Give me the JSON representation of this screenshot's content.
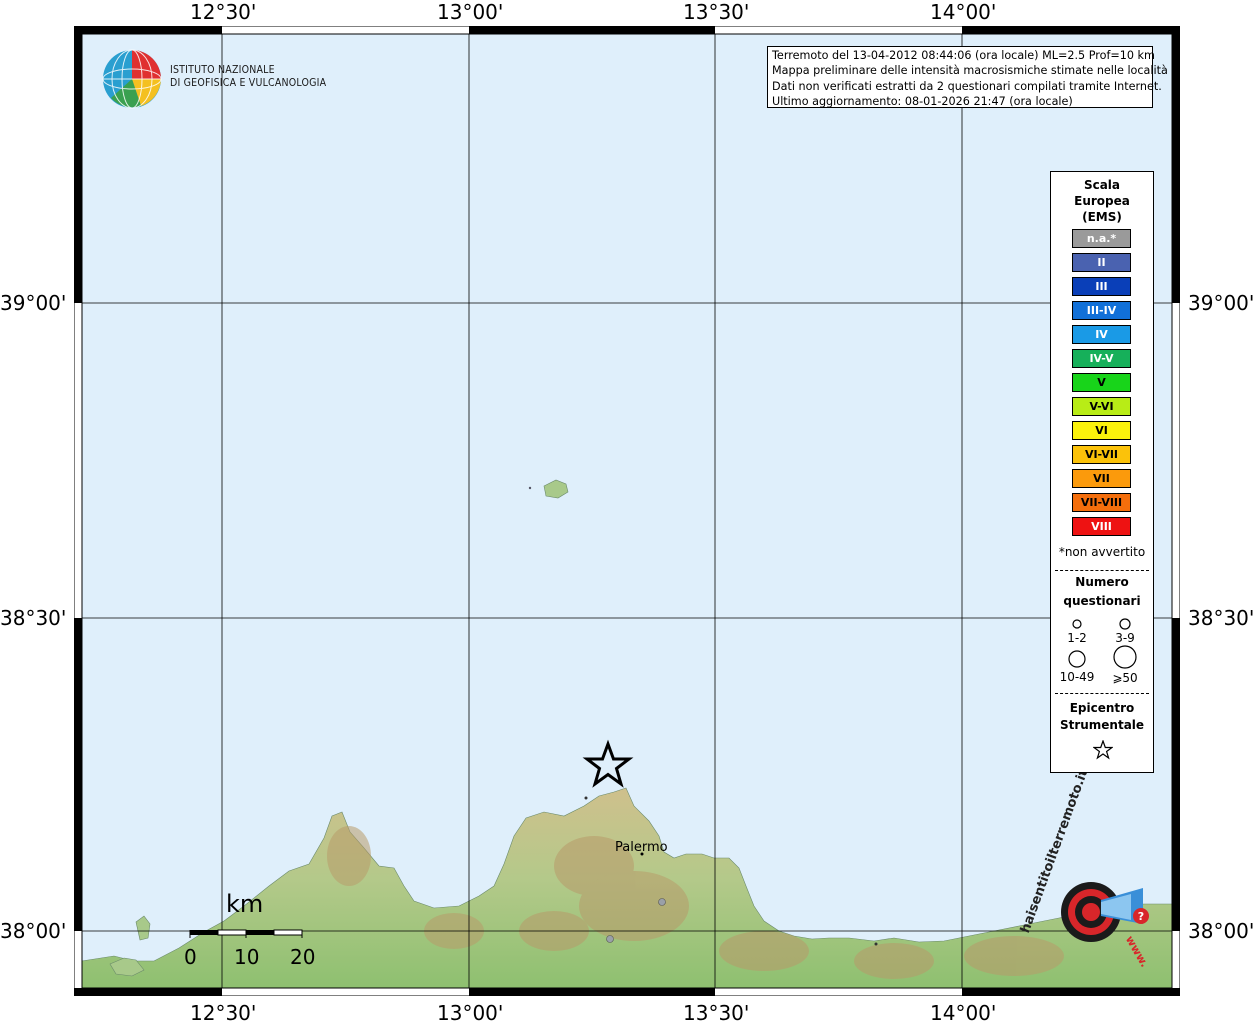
{
  "title": "",
  "logo": {
    "line1": "ISTITUTO NAZIONALE",
    "line2": "DI GEOFISICA E VULCANOLOGIA"
  },
  "info_box": [
    "Terremoto del 13-04-2012 08:44:06 (ora locale) ML=2.5 Prof=10 km",
    "Mappa preliminare delle intensità macrosismiche stimate nelle località",
    "Dati non verificati estratti da 2 questionari compilati tramite Internet.",
    "Ultimo aggiornamento: 08-01-2026 21:47 (ora locale)"
  ],
  "axis": {
    "lon_ticks": [
      "12°30'",
      "13°00'",
      "13°30'",
      "14°00'"
    ],
    "lat_ticks": [
      "39°00'",
      "38°30'",
      "38°00'"
    ]
  },
  "legend": {
    "title_lines": [
      "Scala",
      "Europea",
      "(EMS)"
    ],
    "intensities": [
      {
        "label": "n.a.*",
        "color": "#9a9a9a"
      },
      {
        "label": "II",
        "color": "#4a62b0"
      },
      {
        "label": "III",
        "color": "#0a3fb8"
      },
      {
        "label": "III-IV",
        "color": "#1170d8"
      },
      {
        "label": "IV",
        "color": "#1a9ae6"
      },
      {
        "label": "IV-V",
        "color": "#16b05a"
      },
      {
        "label": "V",
        "color": "#18d41a"
      },
      {
        "label": "V-VI",
        "color": "#b8ec16"
      },
      {
        "label": "VI",
        "color": "#fbf20c"
      },
      {
        "label": "VI-VII",
        "color": "#fbc20a"
      },
      {
        "label": "VII",
        "color": "#fb9a0c"
      },
      {
        "label": "VII-VIII",
        "color": "#f46e0c"
      },
      {
        "label": "VIII",
        "color": "#ee1212"
      }
    ],
    "na_note": "*non avvertito",
    "count_title_lines": [
      "Numero",
      "questionari"
    ],
    "count_labels": [
      "1-2",
      "3-9",
      "10-49",
      "⩾50"
    ],
    "epicenter_title_lines": [
      "Epicentro",
      "Strumentale"
    ]
  },
  "places": [
    {
      "name": "Palermo"
    }
  ],
  "scale_bar": {
    "unit": "km",
    "labels": [
      "0",
      "10",
      "20"
    ]
  },
  "watermark": {
    "text": "haisentitoilterremoto.it",
    "url_text": "www."
  },
  "colors": {
    "sea": "#dfeffb",
    "land_low": "#9dc87a",
    "land_mid": "#c9c48c",
    "land_high": "#b89a6a"
  }
}
